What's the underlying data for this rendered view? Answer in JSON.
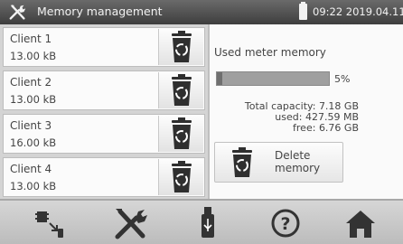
{
  "titlebar": {
    "title": "Memory management",
    "datetime": "09:22 2019.04.11",
    "icon": "tools-icon"
  },
  "clients": [
    {
      "name": "Client 1",
      "size": "13.00 kB"
    },
    {
      "name": "Client 2",
      "size": "13.00 kB"
    },
    {
      "name": "Client 3",
      "size": "16.00 kB"
    },
    {
      "name": "Client 4",
      "size": "13.00 kB"
    }
  ],
  "memory": {
    "label": "Used meter memory",
    "percent_text": "5%",
    "percent": 5,
    "total_label": "Total capacity:",
    "total_value": "7.18 GB",
    "used_label": "used:",
    "used_value": "427.59 MB",
    "free_label": "free:",
    "free_value": "6.76 GB",
    "delete_line1": "Delete",
    "delete_line2": "memory"
  },
  "bottom_nav": [
    "meter-transfer-icon",
    "tools-icon",
    "usb-stick-icon",
    "help-icon",
    "home-icon"
  ],
  "colors": {
    "titlebar": "#4a4a4a",
    "panel": "#d4d4d4",
    "icon": "#3a3a3a"
  }
}
